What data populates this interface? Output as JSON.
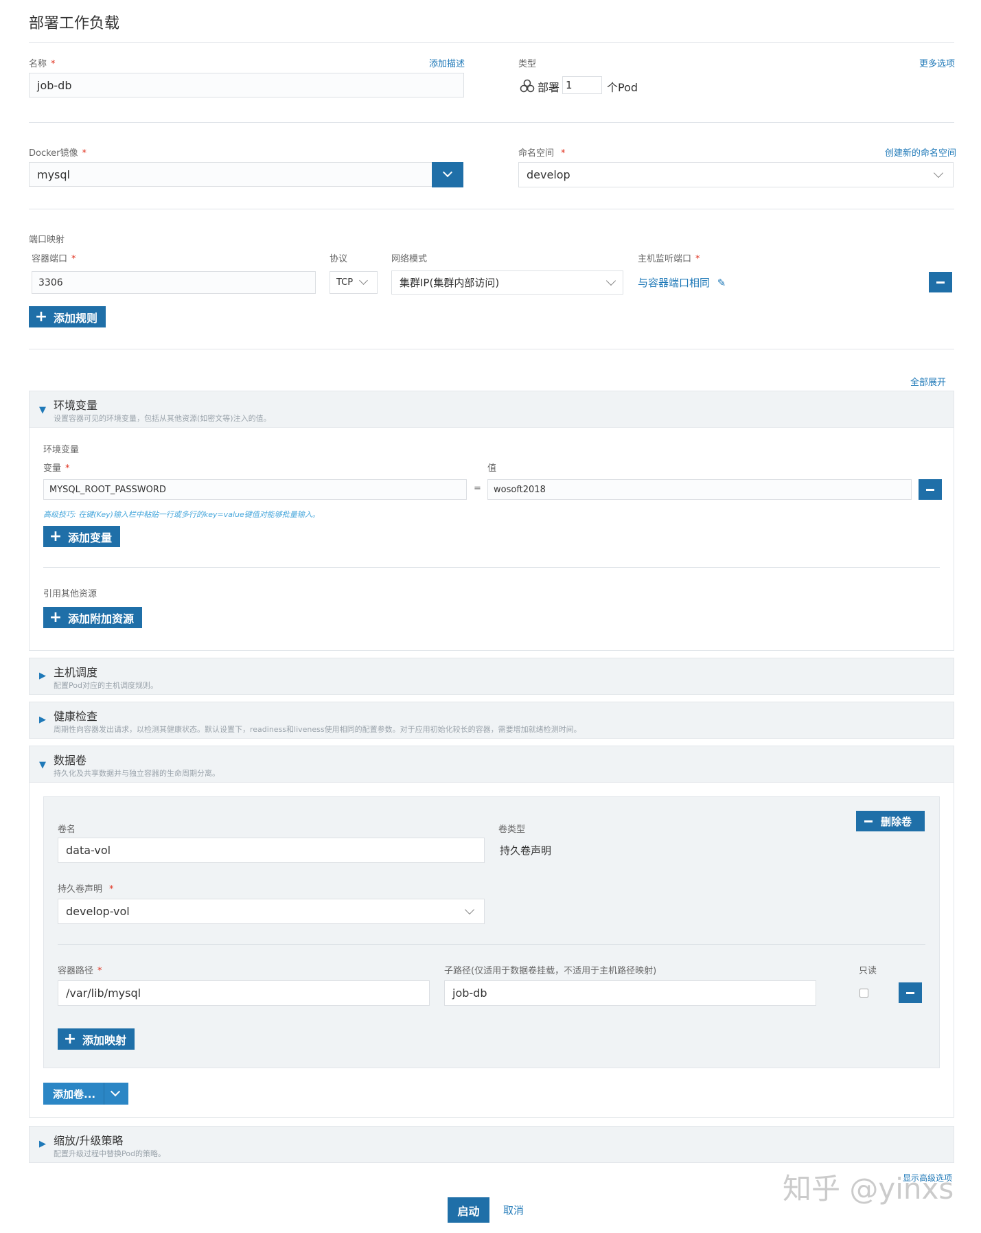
{
  "page_title": "部署工作负载",
  "name_section": {
    "label": "名称",
    "add_desc": "添加描述",
    "value": "job-db",
    "type_label": "类型",
    "more_options": "更多选项",
    "deploy_label": "部署",
    "pod_count": "1",
    "pod_unit": "个Pod"
  },
  "image_section": {
    "label": "Docker镜像",
    "value": "mysql",
    "ns_label": "命名空间",
    "ns_create": "创建新的命名空间",
    "ns_value": "develop"
  },
  "ports": {
    "section_label": "端口映射",
    "container_port_label": "容器端口",
    "protocol_label": "协议",
    "network_label": "网络模式",
    "host_port_label": "主机监听端口",
    "container_port": "3306",
    "protocol": "TCP",
    "network_mode": "集群IP(集群内部访问)",
    "host_port": "与容器端口相同",
    "add_rule": "添加规则"
  },
  "expand_all": "全部展开",
  "env": {
    "title": "环境变量",
    "desc": "设置容器可见的环境变量，包括从其他资源(如密文等)注入的值。",
    "sub_label": "环境变量",
    "var_label": "变量",
    "val_label": "值",
    "var_value": "MYSQL_ROOT_PASSWORD",
    "eq": "=",
    "val_value": "wosoft2018",
    "tip": "高级技巧: 在键(Key)输入栏中粘贴一行或多行的key=value键值对能够批量输入。",
    "add_var": "添加变量",
    "ref_label": "引用其他资源",
    "add_ref": "添加附加资源"
  },
  "scheduling": {
    "title": "主机调度",
    "desc": "配置Pod对应的主机调度规则。"
  },
  "health": {
    "title": "健康检查",
    "desc": "周期性向容器发出请求，以检测其健康状态。默认设置下，readiness和liveness使用相同的配置参数。对于应用初始化较长的容器，需要增加就绪检测时间。"
  },
  "volumes": {
    "title": "数据卷",
    "desc": "持久化及共享数据并与独立容器的生命周期分离。",
    "vol_name_label": "卷名",
    "vol_name": "data-vol",
    "vol_type_label": "卷类型",
    "vol_type": "持久卷声明",
    "delete_vol": "删除卷",
    "pvc_label": "持久卷声明",
    "pvc_value": "develop-vol",
    "container_path_label": "容器路径",
    "sub_path_label": "子路径(仅适用于数据卷挂载，不适用于主机路径映射)",
    "readonly_label": "只读",
    "container_path": "/var/lib/mysql",
    "sub_path": "job-db",
    "add_mount": "添加映射",
    "add_volume": "添加卷..."
  },
  "scaling": {
    "title": "缩放/升级策略",
    "desc": "配置升级过程中替换Pod的策略。"
  },
  "show_advanced": "显示高级选项",
  "watermark": "知乎 @yinxs",
  "actions": {
    "start": "启动",
    "cancel": "取消"
  }
}
